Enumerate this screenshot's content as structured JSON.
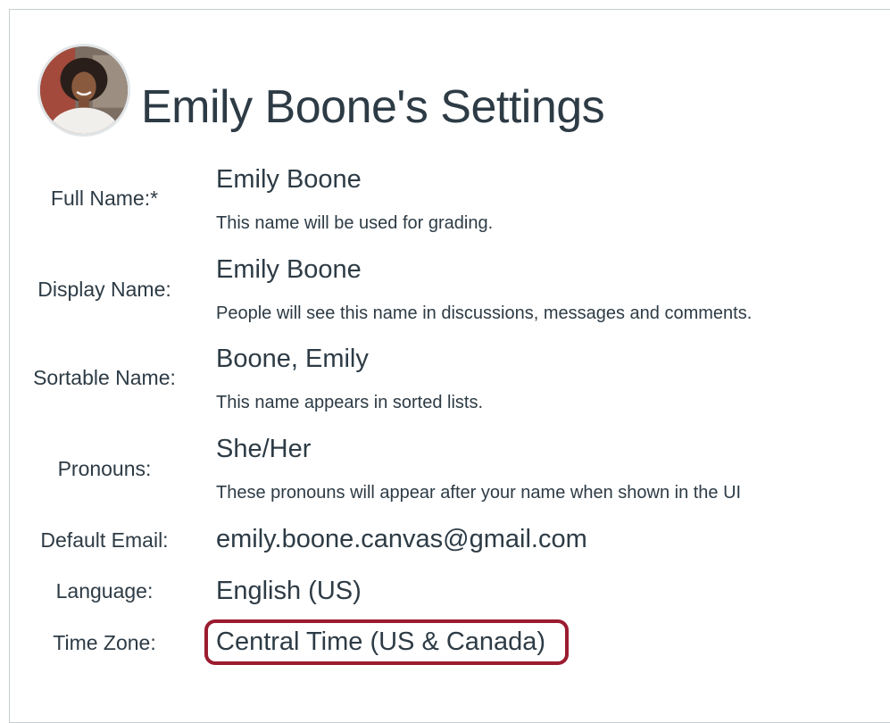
{
  "header": {
    "title": "Emily Boone's Settings"
  },
  "fields": [
    {
      "label": "Full Name:*",
      "value": "Emily Boone",
      "hint": "This name will be used for grading."
    },
    {
      "label": "Display Name:",
      "value": "Emily Boone",
      "hint": "People will see this name in discussions, messages and comments."
    },
    {
      "label": "Sortable Name:",
      "value": "Boone, Emily",
      "hint": "This name appears in sorted lists."
    },
    {
      "label": "Pronouns:",
      "value": "She/Her",
      "hint": "These pronouns will appear after your name when shown in the UI"
    },
    {
      "label": "Default Email:",
      "value": "emily.boone.canvas@gmail.com"
    },
    {
      "label": "Language:",
      "value": "English (US)"
    },
    {
      "label": "Time Zone:",
      "value": "Central Time (US & Canada)"
    }
  ],
  "colors": {
    "text": "#2d3b45",
    "highlight_border": "#9b1b2f",
    "frame_border": "#c7cdd1"
  }
}
